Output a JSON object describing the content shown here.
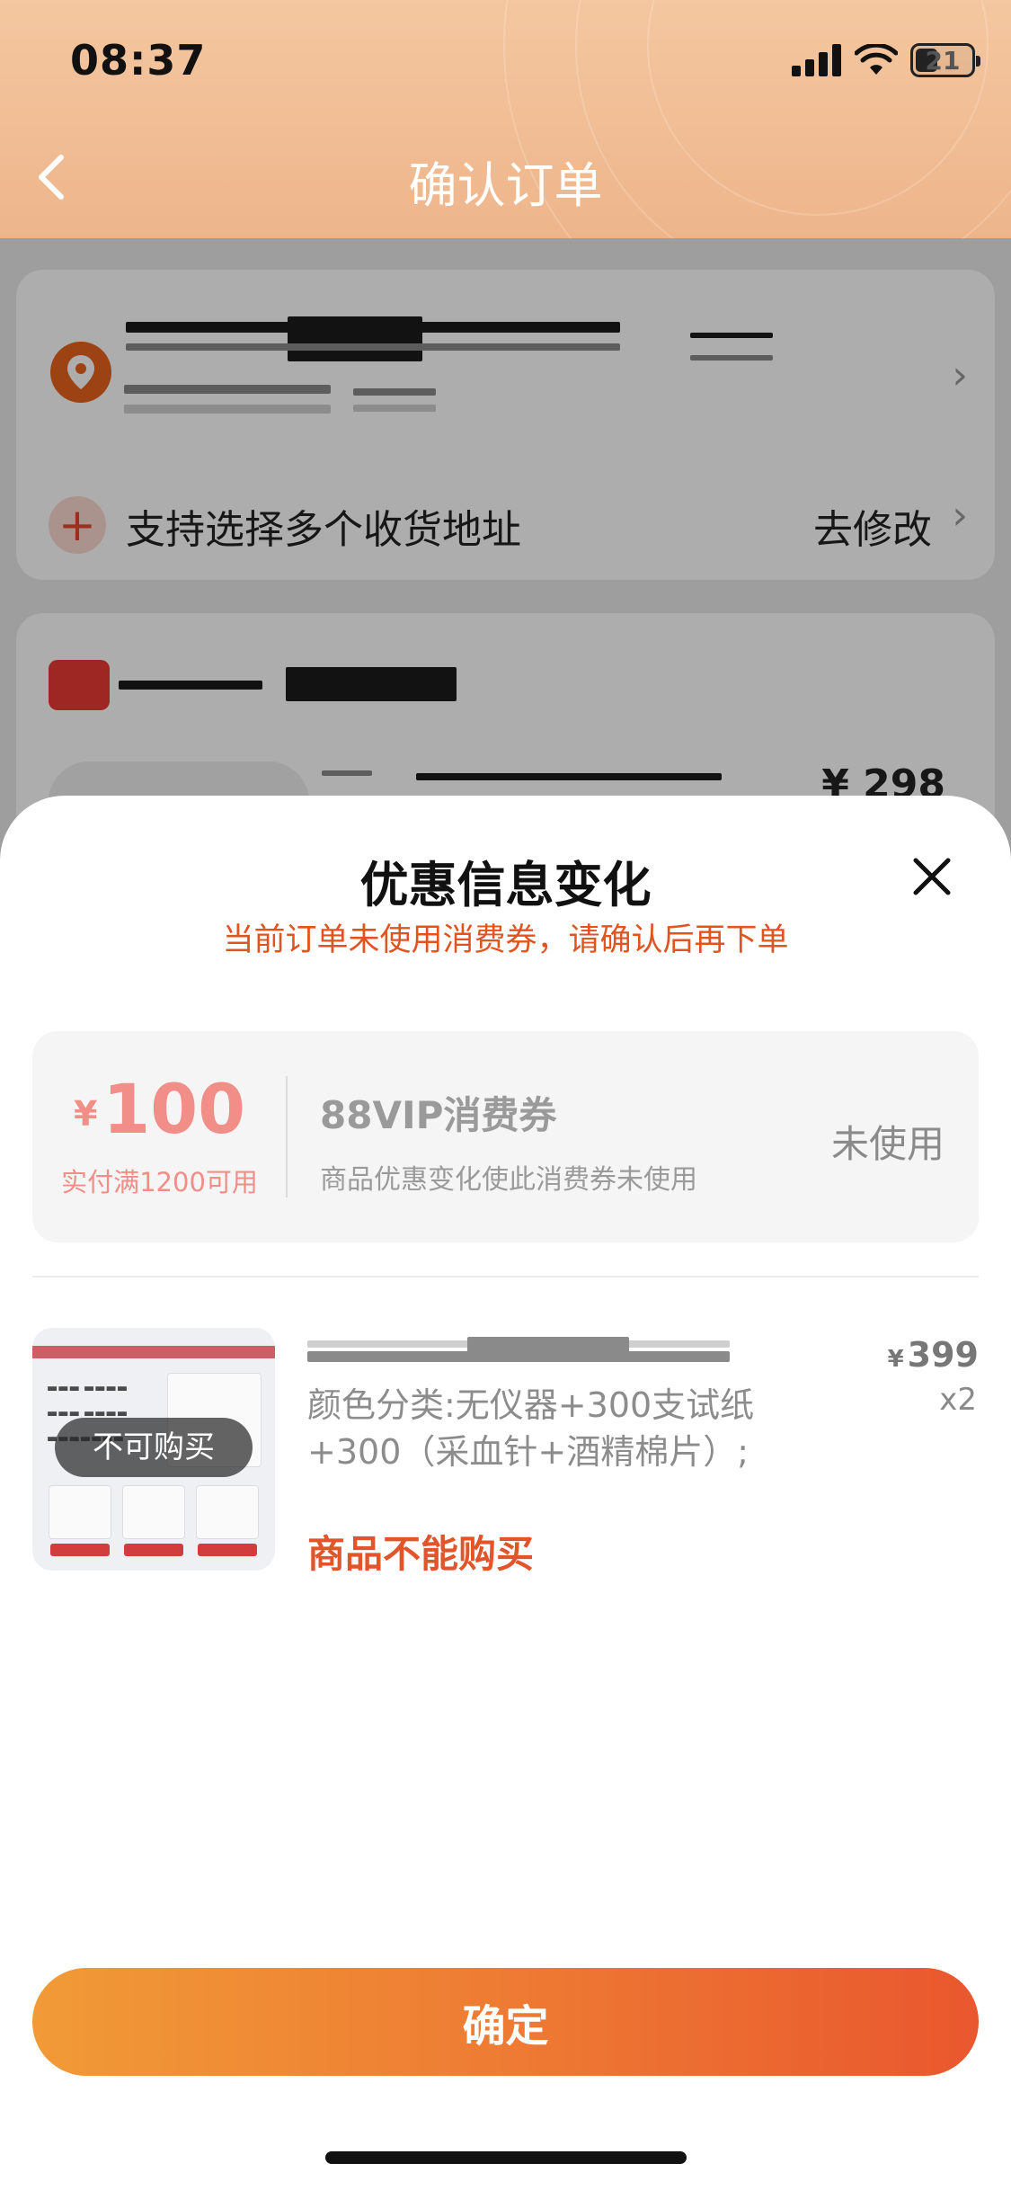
{
  "status_bar": {
    "time": "08:37",
    "battery": "21"
  },
  "nav": {
    "title": "确认订单"
  },
  "address": {
    "multi_address_label": "支持选择多个收货地址",
    "edit_label": "去修改"
  },
  "shop": {
    "item_price": "¥ 298"
  },
  "sheet": {
    "title": "优惠信息变化",
    "subtitle": "当前订单未使用消费券，请确认后再下单",
    "coupon": {
      "currency": "¥",
      "amount": "100",
      "condition": "实付满1200可用",
      "name": "88VIP消费券",
      "description": "商品优惠变化使此消费券未使用",
      "status": "未使用"
    },
    "product": {
      "unavailable_badge": "不可购买",
      "spec": "颜色分类:无仪器+300支试纸+300（采血针+酒精棉片）;",
      "warning": "商品不能购买",
      "currency": "¥",
      "price": "399",
      "quantity": "x2"
    },
    "confirm_label": "确定"
  },
  "colors": {
    "accent": "#e2552a",
    "header_top": "#f4c7a0",
    "header_bottom": "#eeb58b",
    "coupon_text": "#f08e87",
    "button_start": "#f19a37",
    "button_end": "#e9572e"
  }
}
